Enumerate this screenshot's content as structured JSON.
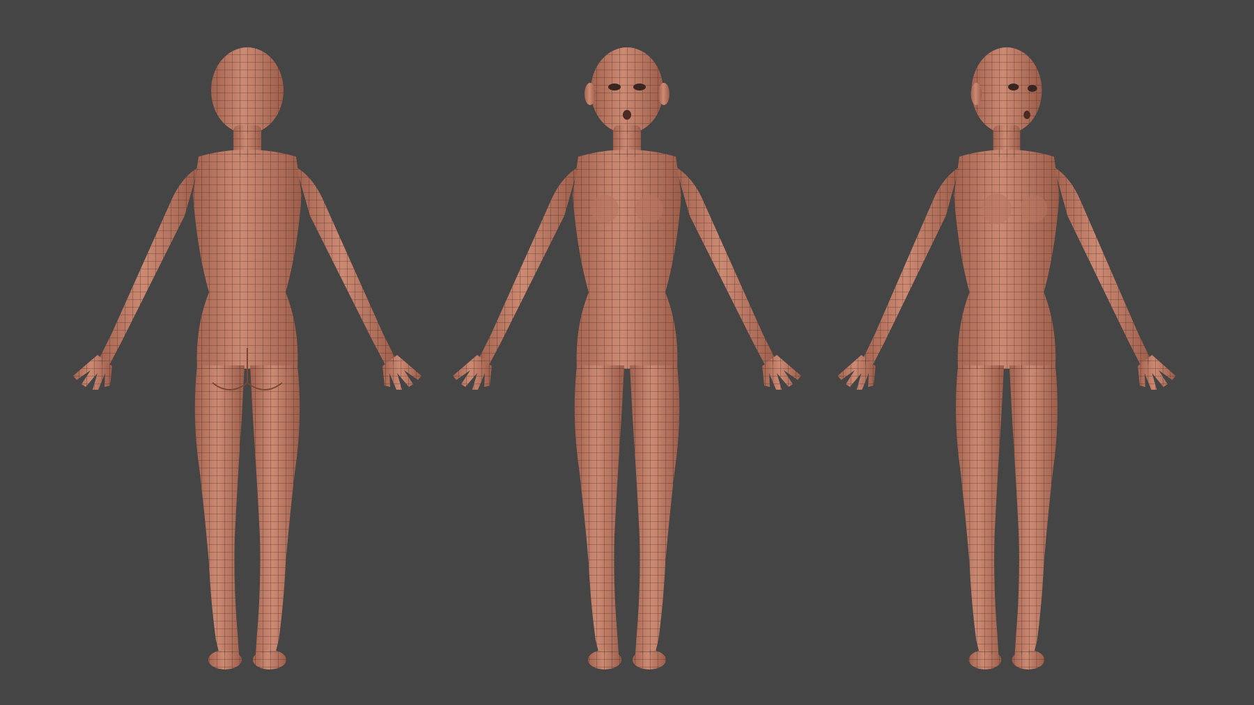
{
  "scene": {
    "background_color": "#454545",
    "skin_color": "#c5826c",
    "skin_shade_color": "#9c5f4c",
    "wire_color": "#2e2420",
    "views": [
      {
        "name": "back-view",
        "facing": "back"
      },
      {
        "name": "front-view",
        "facing": "front"
      },
      {
        "name": "three-quarter-view",
        "facing": "three-quarter"
      }
    ]
  }
}
